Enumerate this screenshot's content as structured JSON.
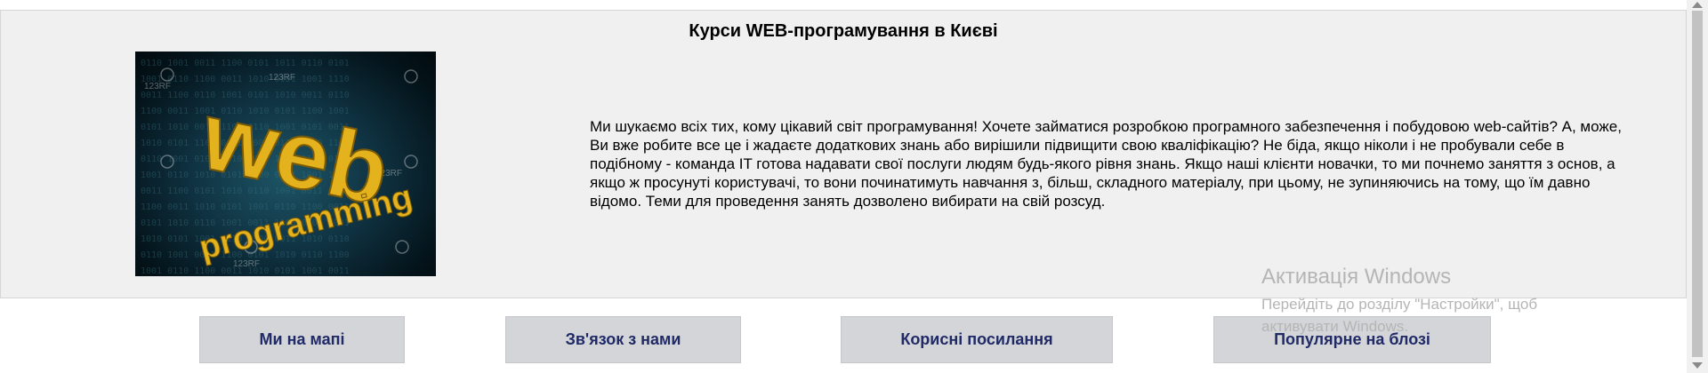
{
  "page": {
    "title": "Курси WEB-програмування в Києві",
    "description": "Ми шукаємо всіх тих, кому цікавий світ програмування! Хочете займатися розробкою програмного забезпечення і побудовою web-сайтів? А, може, Ви вже робите все це і жадаєте додаткових знань або вирішили підвищити свою кваліфікацію? Не біда, якщо ніколи і не пробували себе в подібному - команда IT готова надавати свої послуги людям будь-якого рівня знань. Якщо наші клієнти новачки, то ми почнемо заняття з основ, а якщо ж просунуті користувачі, то вони починатимуть навчання з, більш, складного матеріалу, при цьому, не зупиняючись на тому, що їм давно відомо. Теми для проведення занять дозволено вибирати на свій розсуд."
  },
  "hero_image": {
    "word1": "web",
    "word2": "programming",
    "stock_marks": "123RF"
  },
  "nav": {
    "map": "Ми на мапі",
    "contact": "Зв'язок з нами",
    "links": "Корисні посилання",
    "blog": "Популярне на блозі"
  },
  "watermark": {
    "title": "Активація Windows",
    "subtitle": "Перейдіть до розділу \"Настройки\", щоб активувати Windows."
  },
  "colors": {
    "panel_bg": "#f0f0f0",
    "button_bg": "#d4d5d8",
    "button_text": "#1f2a66",
    "hero_gold": "#e0b020"
  }
}
